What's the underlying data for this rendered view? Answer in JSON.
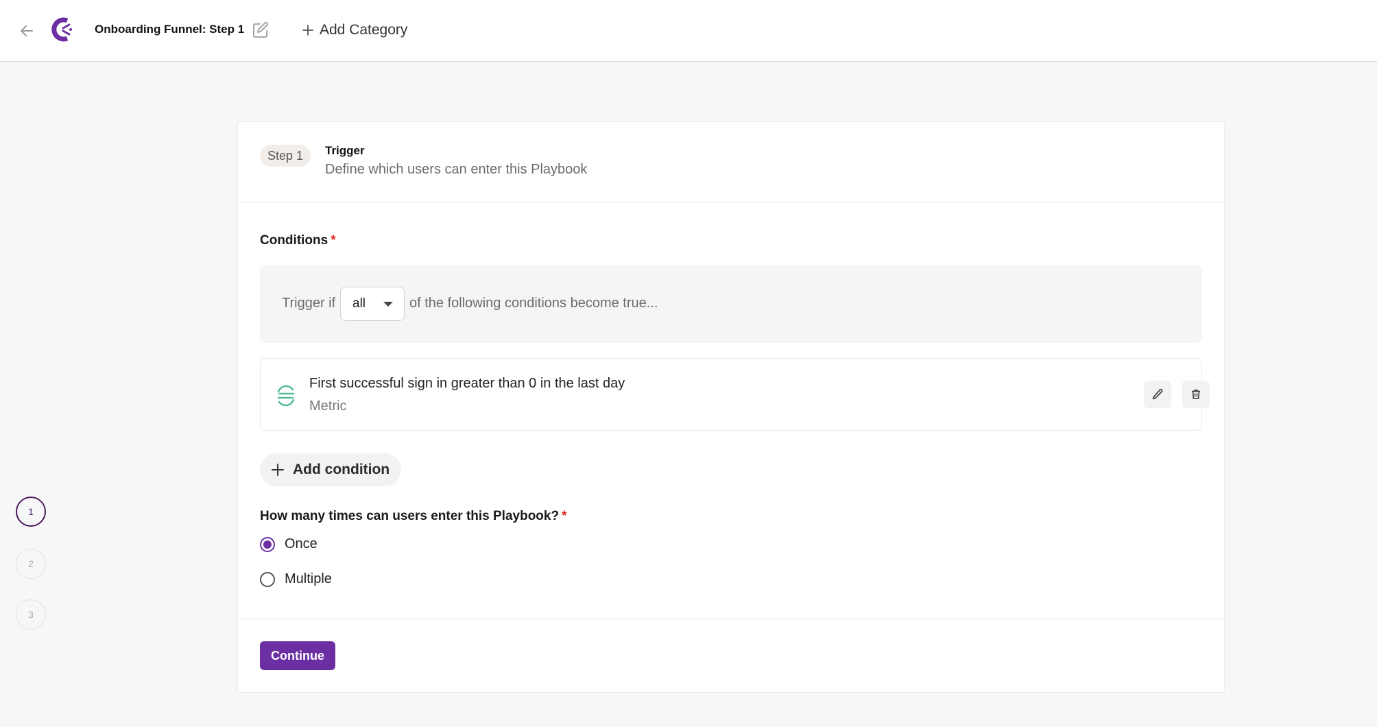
{
  "header": {
    "title": "Onboarding Funnel: Step 1",
    "add_category_label": "Add Category",
    "back_icon": "arrow-left-icon",
    "edit_icon": "pencil-square-icon",
    "logo_color": "#6b2fa3"
  },
  "stepper": {
    "steps": [
      {
        "label": "1",
        "active": true
      },
      {
        "label": "2",
        "active": false
      },
      {
        "label": "3",
        "active": false
      }
    ]
  },
  "card": {
    "step_badge": "Step 1",
    "title": "Trigger",
    "subtitle": "Define which users can enter this Playbook",
    "conditions_label": "Conditions",
    "required_mark": "*",
    "trigger": {
      "prefix": "Trigger if",
      "selected": "all",
      "suffix": "of the following conditions become true..."
    },
    "conditions": [
      {
        "title": "First successful sign in greater than 0 in the last day",
        "type": "Metric",
        "icon": "segment-icon"
      }
    ],
    "add_condition_label": "Add condition",
    "entry_question": "How many times can users enter this Playbook?",
    "entry_options": [
      {
        "label": "Once",
        "checked": true
      },
      {
        "label": "Multiple",
        "checked": false
      }
    ],
    "continue_label": "Continue"
  },
  "colors": {
    "accent": "#6b2fa3",
    "required": "#e02020",
    "segment_green": "#52bd94"
  }
}
